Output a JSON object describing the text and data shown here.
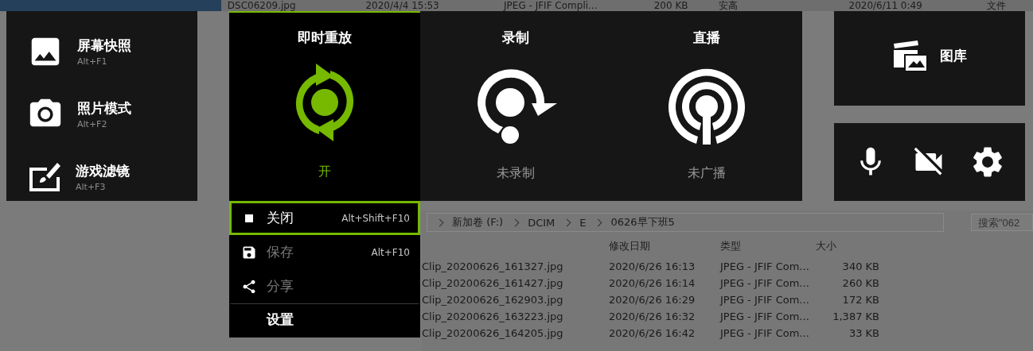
{
  "background": {
    "top_row": [
      {
        "name": "DSC06209.jpg",
        "modified": "2020/4/4 15:53",
        "type": "JPEG - JFIF Compli...",
        "size": "200 KB"
      },
      {
        "name": "安高",
        "modified": "2020/6/11 0:49",
        "type": "文件"
      }
    ],
    "explorer": {
      "breadcrumb": [
        "新加卷 (F:)",
        "DCIM",
        "E",
        "0626早下班5"
      ],
      "search": {
        "placeholder": "搜索\"062"
      },
      "columns": [
        "修改日期",
        "类型",
        "大小"
      ],
      "rows": [
        {
          "name": "Clip_20200626_161327.jpg",
          "modified": "2020/6/26 16:13",
          "type": "JPEG - JFIF Com...",
          "size": "340 KB"
        },
        {
          "name": "Clip_20200626_161427.jpg",
          "modified": "2020/6/26 16:14",
          "type": "JPEG - JFIF Com...",
          "size": "260 KB"
        },
        {
          "name": "Clip_20200626_162903.jpg",
          "modified": "2020/6/26 16:29",
          "type": "JPEG - JFIF Com...",
          "size": "172 KB"
        },
        {
          "name": "Clip_20200626_163223.jpg",
          "modified": "2020/6/26 16:32",
          "type": "JPEG - JFIF Com...",
          "size": "1,387 KB"
        },
        {
          "name": "Clip_20200626_164205.jpg",
          "modified": "2020/6/26 16:42",
          "type": "JPEG - JFIF Com...",
          "size": "33 KB"
        }
      ]
    }
  },
  "capture_panel": {
    "items": [
      {
        "kind": "screenshot",
        "title": "屏幕快照",
        "shortcut": "Alt+F1"
      },
      {
        "kind": "photo",
        "title": "照片模式",
        "shortcut": "Alt+F2"
      },
      {
        "kind": "filter",
        "title": "游戏滤镜",
        "shortcut": "Alt+F3"
      }
    ]
  },
  "instant_replay": {
    "title": "即时重放",
    "on": true,
    "status": "开",
    "menu": [
      {
        "kind": "stop",
        "label": "关闭",
        "shortcut": "Alt+Shift+F10",
        "selected": true,
        "disabled": false
      },
      {
        "kind": "save",
        "label": "保存",
        "shortcut": "Alt+F10",
        "selected": false,
        "disabled": true
      },
      {
        "kind": "share",
        "label": "分享",
        "selected": false,
        "disabled": true
      },
      {
        "kind": "settings",
        "label": "设置",
        "selected": false,
        "disabled": false
      }
    ]
  },
  "features": [
    {
      "kind": "record",
      "title": "录制",
      "status": "未录制",
      "on": false
    },
    {
      "kind": "broadcast",
      "title": "直播",
      "status": "未广播",
      "on": false
    }
  ],
  "gallery": {
    "label": "图库"
  },
  "toggles": [
    {
      "kind": "microphone",
      "on": true
    },
    {
      "kind": "camera",
      "on": false
    },
    {
      "kind": "settings"
    }
  ]
}
